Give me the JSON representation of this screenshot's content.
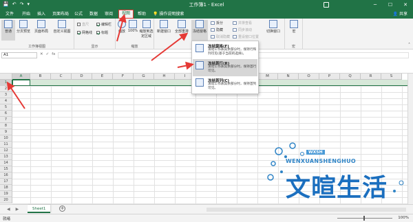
{
  "window": {
    "title": "工作簿1 - Excel",
    "share": "共享",
    "qat": [
      "💾",
      "↶",
      "↷",
      "▾"
    ]
  },
  "tabs": [
    "文件",
    "开始",
    "插入",
    "页面布局",
    "公式",
    "数据",
    "审阅",
    "视图",
    "帮助",
    "操作说明搜索"
  ],
  "active_tab": "视图",
  "ribbon": {
    "workbook_views": {
      "label": "工作簿视图",
      "buttons": [
        "普通",
        "分页预览",
        "页面布局",
        "自定义视图"
      ]
    },
    "show": {
      "label": "显示",
      "items": [
        {
          "label": "直尺",
          "checked": false
        },
        {
          "label": "网格线",
          "checked": true
        },
        {
          "label": "编辑栏",
          "checked": true
        },
        {
          "label": "标题",
          "checked": true
        }
      ]
    },
    "zoom": {
      "label": "缩放",
      "buttons": [
        "缩放",
        "100%",
        "缩放到选定区域"
      ]
    },
    "window": {
      "buttons": [
        "新建窗口",
        "全部重排",
        "冻结窗格"
      ],
      "small": [
        "拆分",
        "隐藏",
        "取消隐藏"
      ],
      "small_right": [
        "并排查看",
        "同步滚动",
        "重设窗口位置"
      ],
      "switch_window": "切换窗口"
    },
    "macros": {
      "button": "宏",
      "label": "宏"
    }
  },
  "formula_bar": {
    "name_box": "A1",
    "fx": "fx"
  },
  "columns": [
    "A",
    "B",
    "C",
    "D",
    "E",
    "F",
    "G",
    "H",
    "I",
    "J",
    "K",
    "L",
    "M",
    "N",
    "O",
    "P",
    "Q",
    "R",
    "S"
  ],
  "rows": [
    "1",
    "2",
    "3",
    "4",
    "5",
    "6",
    "7",
    "8",
    "9",
    "10",
    "11",
    "12",
    "13",
    "14",
    "15",
    "16",
    "17",
    "18",
    "19",
    "20"
  ],
  "freeze_menu": [
    {
      "title": "冻结窗格(F)",
      "desc": "滚动工作表其余部分时，保持行和列可见(基于当前的选择)。",
      "highlighted": false
    },
    {
      "title": "冻结首行(R)",
      "desc": "滚动工作表其余部分时，保持首行可见。",
      "highlighted": true
    },
    {
      "title": "冻结首列(C)",
      "desc": "滚动工作表其余部分时，保持首列可见。",
      "highlighted": false
    }
  ],
  "sheet_tabs": [
    "Sheet1"
  ],
  "status": {
    "ready": "就绪",
    "zoom": "100%"
  },
  "watermark": {
    "tag": "WXSH",
    "small": "WENXUANSHENGHUO",
    "big": "文暄生活"
  },
  "colors": {
    "excel_green": "#217346",
    "arrow_red": "#e53935",
    "watermark_blue": "#1b6fbf"
  }
}
